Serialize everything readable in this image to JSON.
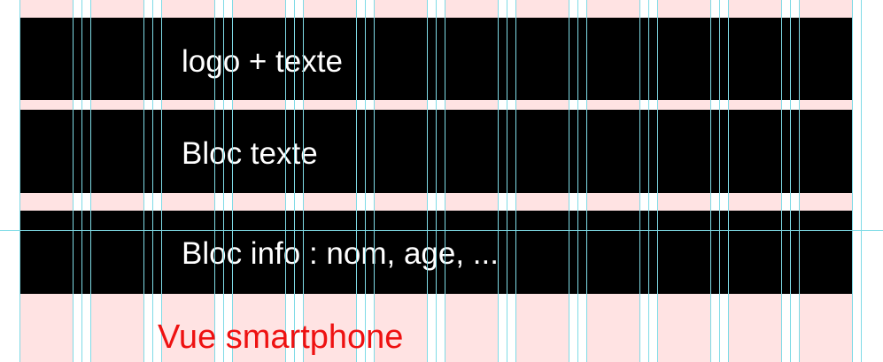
{
  "blocks": [
    {
      "label": "logo + texte"
    },
    {
      "label": "Bloc texte"
    },
    {
      "label": "Bloc info : nom, age, ..."
    }
  ],
  "caption": "Vue smartphone",
  "colors": {
    "background": "#ffffff",
    "column": "#ffe3e3",
    "guide": "#7fdbe6",
    "block": "#000000",
    "block_text": "#ffffff",
    "caption": "#ee1111"
  }
}
